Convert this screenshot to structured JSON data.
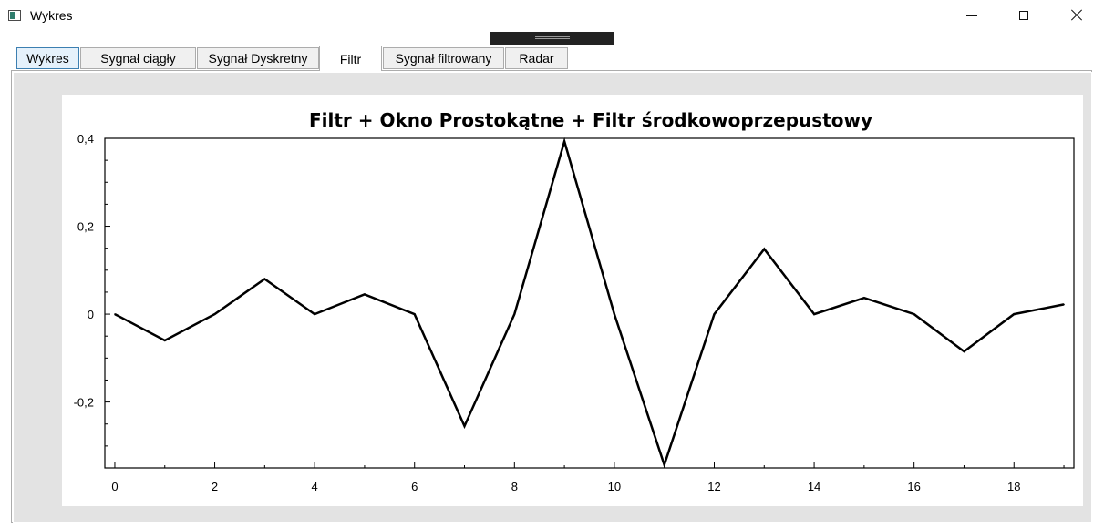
{
  "window": {
    "title": "Wykres",
    "icon": "app-window-icon",
    "controls": [
      "minimize-icon",
      "maximize-icon",
      "close-icon"
    ]
  },
  "tabs": [
    {
      "label": "Wykres",
      "state": "hover"
    },
    {
      "label": "Sygnał ciągły",
      "state": "normal"
    },
    {
      "label": "Sygnał Dyskretny",
      "state": "normal"
    },
    {
      "label": "Filtr",
      "state": "selected"
    },
    {
      "label": "Sygnał filtrowany",
      "state": "normal"
    },
    {
      "label": "Radar",
      "state": "normal"
    }
  ],
  "colors": {
    "line": "#000000",
    "plot_bg": "#ffffff",
    "panel_bg": "#e3e3e3",
    "hover_tab": "#e5f1fb"
  },
  "chart_data": {
    "type": "line",
    "title": "Filtr + Okno Prostokątne + Filtr środkowoprzepustowy",
    "xlabel": "",
    "ylabel": "",
    "xlim": [
      -0.2,
      19.2
    ],
    "ylim": [
      -0.35,
      0.4
    ],
    "xticks": [
      0,
      2,
      4,
      6,
      8,
      10,
      12,
      14,
      16,
      18
    ],
    "xtick_labels": [
      "0",
      "2",
      "4",
      "6",
      "8",
      "10",
      "12",
      "14",
      "16",
      "18"
    ],
    "yticks": [
      0.4,
      0.2,
      0,
      -0.2
    ],
    "ytick_labels": [
      "0,4",
      "0,2",
      "0",
      "-0,2"
    ],
    "grid": false,
    "legend": "none",
    "series": [
      {
        "x": [
          0,
          1,
          2,
          3,
          4,
          5,
          6,
          7,
          8,
          9,
          10,
          11,
          12,
          13,
          14,
          15,
          16,
          17,
          18,
          19
        ],
        "values": [
          0,
          -0.06,
          0,
          0.08,
          0,
          0.045,
          0,
          -0.255,
          0,
          0.393,
          0,
          -0.343,
          0,
          0.148,
          0,
          0.037,
          0,
          -0.085,
          0,
          0.022
        ]
      }
    ]
  }
}
